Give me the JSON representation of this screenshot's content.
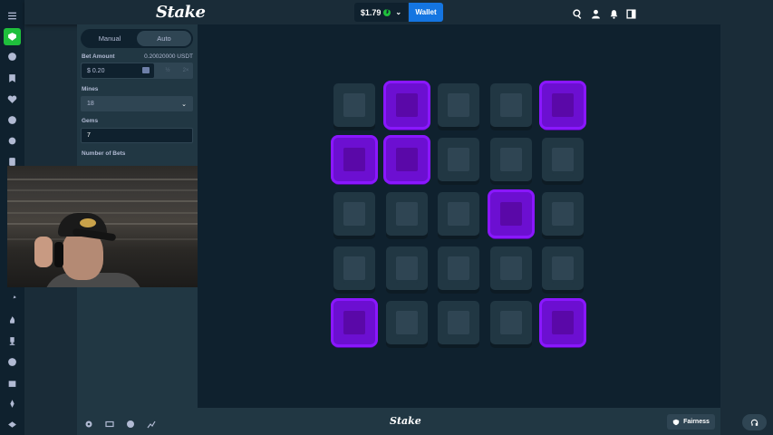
{
  "header": {
    "logo": "Stake",
    "balance": "$1.79",
    "balance_coin_symbol": "₮",
    "wallet_label": "Wallet"
  },
  "sidebar": {
    "icons": [
      "menu-icon",
      "casino-icon",
      "sports-icon",
      "bookmark-icon",
      "heart-icon",
      "chat-icon",
      "settings-icon",
      "document-icon",
      "wrench-icon",
      "fire-icon",
      "trophy-icon",
      "target-icon",
      "gift-icon",
      "rocket-icon",
      "handshake-icon"
    ]
  },
  "controls": {
    "tab_manual": "Manual",
    "tab_auto": "Auto",
    "bet_amount_label": "Bet Amount",
    "bet_amount_value_right": "0.20020000 USDT",
    "bet_amount_input": "$ 0.20",
    "half_label": "½",
    "double_label": "2×",
    "mines_label": "Mines",
    "mines_value": "18",
    "gems_label": "Gems",
    "gems_value": "7",
    "number_of_bets_label": "Number of Bets"
  },
  "grid": {
    "rows": 5,
    "cols": 5,
    "revealed_gems": [
      [
        0,
        1
      ],
      [
        0,
        4
      ],
      [
        1,
        0
      ],
      [
        1,
        1
      ],
      [
        2,
        3
      ],
      [
        4,
        0
      ],
      [
        4,
        4
      ]
    ]
  },
  "footer": {
    "logo": "Stake",
    "fairness_label": "Fairness"
  },
  "colors": {
    "accent": "#1475e1",
    "gem": "#8a17ff",
    "active_green": "#1fbf3c",
    "bg": "#0f212e"
  }
}
